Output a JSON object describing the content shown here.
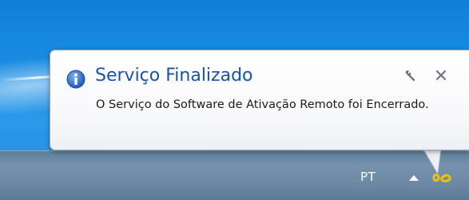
{
  "notification": {
    "title": "Serviço Finalizado",
    "message": "O Serviço do Software de Ativação Remoto foi Encerrado.",
    "icon": "info-icon",
    "options_icon": "wrench-icon",
    "close_icon": "close-icon"
  },
  "taskbar": {
    "language": "PT",
    "tray_arrow_icon": "chevron-up-icon",
    "tray_app_icon": "activation-tray-icon"
  },
  "colors": {
    "title": "#1a54a8",
    "desktop": "#1d8fe4",
    "taskbar": "#6f8ca7",
    "tray_icon": "#f2c200"
  }
}
